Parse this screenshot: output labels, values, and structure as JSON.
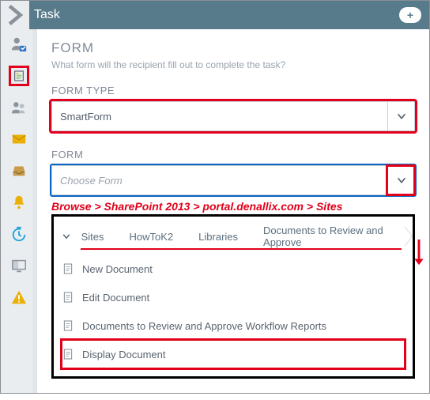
{
  "header": {
    "title": "Task",
    "badge_glyph": "+"
  },
  "form": {
    "section_title": "FORM",
    "section_sub": "What form will the recipient fill out to complete the task?",
    "type_label": "FORM TYPE",
    "type_value": "SmartForm",
    "form_label": "FORM",
    "form_placeholder": "Choose Form"
  },
  "annotation": "Browse > SharePoint 2013 > portal.denallix.com > Sites",
  "breadcrumbs": {
    "items": [
      "Sites",
      "HowToK2",
      "Libraries",
      "Documents to Review and Approve"
    ]
  },
  "documents": {
    "items": [
      "New Document",
      "Edit Document",
      "Documents to Review and Approve Workflow Reports",
      "Display Document"
    ]
  }
}
